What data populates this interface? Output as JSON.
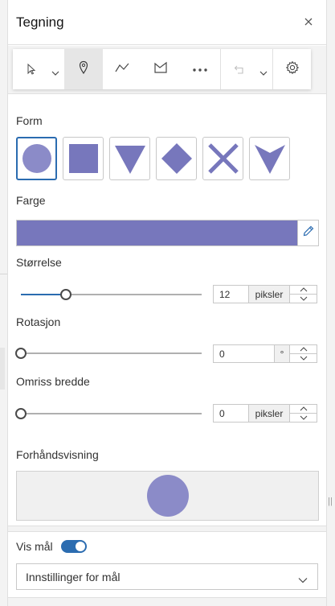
{
  "header": {
    "title": "Tegning",
    "close_icon": "close-icon"
  },
  "toolbar": {
    "tools": [
      {
        "icon": "select-pointer-icon",
        "has_dropdown": true,
        "selected": false
      },
      {
        "icon": "point-pin-icon",
        "has_dropdown": false,
        "selected": true
      },
      {
        "icon": "polyline-icon",
        "has_dropdown": false,
        "selected": false
      },
      {
        "icon": "polygon-icon",
        "has_dropdown": false,
        "selected": false
      },
      {
        "icon": "more-dots-icon",
        "has_dropdown": false,
        "selected": false
      },
      {
        "icon": "undo-icon",
        "has_dropdown": true,
        "selected": false,
        "disabled": true
      },
      {
        "icon": "gear-icon",
        "has_dropdown": false,
        "selected": false
      }
    ]
  },
  "form": {
    "label": "Form",
    "shapes": [
      "circle",
      "square",
      "triangle-down",
      "diamond",
      "x",
      "arrow-down"
    ],
    "selected": "circle"
  },
  "color": {
    "label": "Farge",
    "value": "#7777bc"
  },
  "size": {
    "label": "Størrelse",
    "value": "12",
    "unit": "piksler",
    "slider_fraction": 0.25
  },
  "rotation": {
    "label": "Rotasjon",
    "value": "0",
    "unit": "°",
    "slider_fraction": 0
  },
  "outline": {
    "label": "Omriss bredde",
    "value": "0",
    "unit": "piksler",
    "slider_fraction": 0
  },
  "preview": {
    "label": "Forhåndsvisning"
  },
  "measure": {
    "label": "Vis mål",
    "enabled": true
  },
  "measure_settings": {
    "label": "Innstillinger for mål"
  },
  "colors": {
    "accent": "#2b6cb0",
    "symbol": "#7777bc",
    "preview_symbol": "#8b8bc8"
  }
}
